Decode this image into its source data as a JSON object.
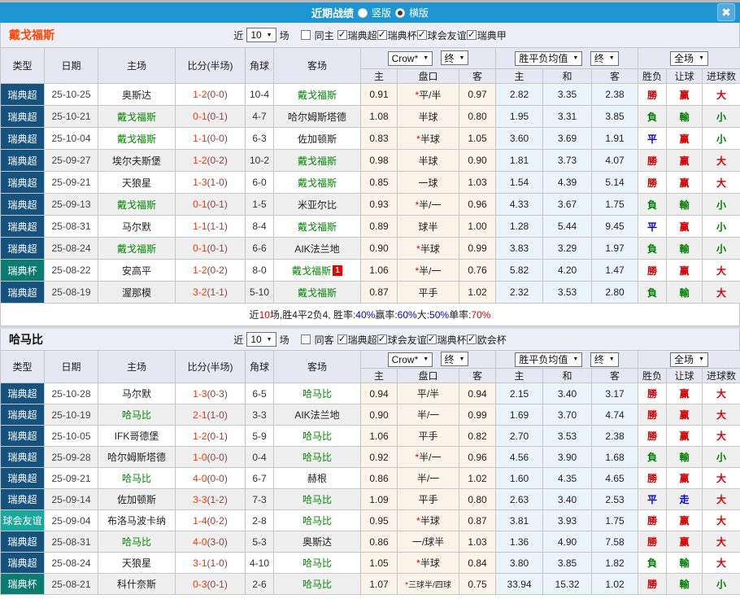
{
  "titlebar": {
    "title": "近期战绩",
    "vertical_label": "竖版",
    "horizontal_label": "横版",
    "close_glyph": "✖",
    "bar_color": "#1e96d3"
  },
  "columns": {
    "type": "类型",
    "date": "日期",
    "home": "主场",
    "score": "比分(半场)",
    "corner": "角球",
    "away": "客场",
    "asia_home": "主",
    "asia_handicap": "盘口",
    "asia_away": "客",
    "euro_home": "主",
    "euro_draw": "和",
    "euro_away": "客",
    "wl": "胜负",
    "handicap_result": "让球",
    "goals": "进球数"
  },
  "dropdowns": {
    "company": "Crow*",
    "company_final": "终",
    "avg": "胜平负均值",
    "avg_final": "终",
    "scope": "全场"
  },
  "league_colors": {
    "瑞典超": "#15527e",
    "瑞典杯": "#0c7c71",
    "球会友谊": "#18a89c"
  },
  "result_colors": {
    "r": "#d70000",
    "g": "#008000",
    "b": "#0000d0"
  },
  "sections": [
    {
      "team": "戴戈福斯",
      "team_color": "#ff4400",
      "filters": {
        "near_label": "近",
        "count": "10",
        "unit_label": "场",
        "same_checked": false,
        "same_label": "同主",
        "leagues": [
          {
            "label": "瑞典超",
            "checked": true
          },
          {
            "label": "瑞典杯",
            "checked": true
          },
          {
            "label": "球会友谊",
            "checked": true
          },
          {
            "label": "瑞典甲",
            "checked": true
          }
        ]
      },
      "rows": [
        {
          "league": "瑞典超",
          "date": "25-10-25",
          "home": "奥斯达",
          "home_focal": false,
          "ft": "1-2",
          "ht": "(0-0)",
          "corner": "10-4",
          "away": "戴戈福斯",
          "away_focal": true,
          "badge": "",
          "asia": [
            "0.91",
            "*平/半",
            "0.97"
          ],
          "euro": [
            "2.82",
            "3.35",
            "2.38"
          ],
          "results": [
            {
              "t": "勝",
              "c": "r"
            },
            {
              "t": "赢",
              "c": "r"
            },
            {
              "t": "大",
              "c": "r"
            }
          ]
        },
        {
          "league": "瑞典超",
          "date": "25-10-21",
          "home": "戴戈福斯",
          "home_focal": true,
          "ft": "0-1",
          "ht": "(0-1)",
          "corner": "4-7",
          "away": "哈尔姆斯塔德",
          "away_focal": false,
          "badge": "",
          "asia": [
            "1.08",
            "半球",
            "0.80"
          ],
          "euro": [
            "1.95",
            "3.31",
            "3.85"
          ],
          "results": [
            {
              "t": "負",
              "c": "g"
            },
            {
              "t": "輸",
              "c": "g"
            },
            {
              "t": "小",
              "c": "g"
            }
          ]
        },
        {
          "league": "瑞典超",
          "date": "25-10-04",
          "home": "戴戈福斯",
          "home_focal": true,
          "ft": "1-1",
          "ht": "(0-0)",
          "corner": "6-3",
          "away": "佐加顿斯",
          "away_focal": false,
          "badge": "",
          "asia": [
            "0.83",
            "*半球",
            "1.05"
          ],
          "euro": [
            "3.60",
            "3.69",
            "1.91"
          ],
          "results": [
            {
              "t": "平",
              "c": "b"
            },
            {
              "t": "赢",
              "c": "r"
            },
            {
              "t": "小",
              "c": "g"
            }
          ]
        },
        {
          "league": "瑞典超",
          "date": "25-09-27",
          "home": "埃尔夫斯堡",
          "home_focal": false,
          "ft": "1-2",
          "ht": "(0-2)",
          "corner": "10-2",
          "away": "戴戈福斯",
          "away_focal": true,
          "badge": "",
          "asia": [
            "0.98",
            "半球",
            "0.90"
          ],
          "euro": [
            "1.81",
            "3.73",
            "4.07"
          ],
          "results": [
            {
              "t": "勝",
              "c": "r"
            },
            {
              "t": "赢",
              "c": "r"
            },
            {
              "t": "大",
              "c": "r"
            }
          ]
        },
        {
          "league": "瑞典超",
          "date": "25-09-21",
          "home": "天狼星",
          "home_focal": false,
          "ft": "1-3",
          "ht": "(1-0)",
          "corner": "6-0",
          "away": "戴戈福斯",
          "away_focal": true,
          "badge": "",
          "asia": [
            "0.85",
            "一球",
            "1.03"
          ],
          "euro": [
            "1.54",
            "4.39",
            "5.14"
          ],
          "results": [
            {
              "t": "勝",
              "c": "r"
            },
            {
              "t": "赢",
              "c": "r"
            },
            {
              "t": "大",
              "c": "r"
            }
          ]
        },
        {
          "league": "瑞典超",
          "date": "25-09-13",
          "home": "戴戈福斯",
          "home_focal": true,
          "ft": "0-1",
          "ht": "(0-1)",
          "corner": "1-5",
          "away": "米亚尔比",
          "away_focal": false,
          "badge": "",
          "asia": [
            "0.93",
            "*半/一",
            "0.96"
          ],
          "euro": [
            "4.33",
            "3.67",
            "1.75"
          ],
          "results": [
            {
              "t": "負",
              "c": "g"
            },
            {
              "t": "輸",
              "c": "g"
            },
            {
              "t": "小",
              "c": "g"
            }
          ]
        },
        {
          "league": "瑞典超",
          "date": "25-08-31",
          "home": "马尔默",
          "home_focal": false,
          "ft": "1-1",
          "ht": "(1-1)",
          "corner": "8-4",
          "away": "戴戈福斯",
          "away_focal": true,
          "badge": "",
          "asia": [
            "0.89",
            "球半",
            "1.00"
          ],
          "euro": [
            "1.28",
            "5.44",
            "9.45"
          ],
          "results": [
            {
              "t": "平",
              "c": "b"
            },
            {
              "t": "赢",
              "c": "r"
            },
            {
              "t": "小",
              "c": "g"
            }
          ]
        },
        {
          "league": "瑞典超",
          "date": "25-08-24",
          "home": "戴戈福斯",
          "home_focal": true,
          "ft": "0-1",
          "ht": "(0-1)",
          "corner": "6-6",
          "away": "AIK法兰地",
          "away_focal": false,
          "badge": "",
          "asia": [
            "0.90",
            "*半球",
            "0.99"
          ],
          "euro": [
            "3.83",
            "3.29",
            "1.97"
          ],
          "results": [
            {
              "t": "負",
              "c": "g"
            },
            {
              "t": "輸",
              "c": "g"
            },
            {
              "t": "小",
              "c": "g"
            }
          ]
        },
        {
          "league": "瑞典杯",
          "date": "25-08-22",
          "home": "安高平",
          "home_focal": false,
          "ft": "1-2",
          "ht": "(0-2)",
          "corner": "8-0",
          "away": "戴戈福斯",
          "away_focal": true,
          "badge": "1",
          "asia": [
            "1.06",
            "*半/一",
            "0.76"
          ],
          "euro": [
            "5.82",
            "4.20",
            "1.47"
          ],
          "results": [
            {
              "t": "勝",
              "c": "r"
            },
            {
              "t": "赢",
              "c": "r"
            },
            {
              "t": "大",
              "c": "r"
            }
          ]
        },
        {
          "league": "瑞典超",
          "date": "25-08-19",
          "home": "渥那模",
          "home_focal": false,
          "ft": "3-2",
          "ht": "(1-1)",
          "corner": "5-10",
          "away": "戴戈福斯",
          "away_focal": true,
          "badge": "",
          "asia": [
            "0.87",
            "平手",
            "1.02"
          ],
          "euro": [
            "2.32",
            "3.53",
            "2.80"
          ],
          "results": [
            {
              "t": "負",
              "c": "g"
            },
            {
              "t": "輸",
              "c": "g"
            },
            {
              "t": "大",
              "c": "r"
            }
          ]
        }
      ],
      "summary": [
        {
          "t": "近",
          "c": "k"
        },
        {
          "t": "10",
          "c": "r"
        },
        {
          "t": "场,胜4平2负4, 胜率:",
          "c": "k"
        },
        {
          "t": "40%",
          "c": "b"
        },
        {
          "t": " 赢率:",
          "c": "k"
        },
        {
          "t": "60%",
          "c": "b"
        },
        {
          "t": " 大:",
          "c": "k"
        },
        {
          "t": "50%",
          "c": "b"
        },
        {
          "t": " 单率:",
          "c": "k"
        },
        {
          "t": "70%",
          "c": "r"
        }
      ]
    },
    {
      "team": "哈马比",
      "team_color": "#111111",
      "filters": {
        "near_label": "近",
        "count": "10",
        "unit_label": "场",
        "same_checked": false,
        "same_label": "同客",
        "leagues": [
          {
            "label": "瑞典超",
            "checked": true
          },
          {
            "label": "球会友谊",
            "checked": true
          },
          {
            "label": "瑞典杯",
            "checked": true
          },
          {
            "label": "欧会杯",
            "checked": true
          }
        ]
      },
      "rows": [
        {
          "league": "瑞典超",
          "date": "25-10-28",
          "home": "马尔默",
          "home_focal": false,
          "ft": "1-3",
          "ht": "(0-3)",
          "corner": "6-5",
          "away": "哈马比",
          "away_focal": true,
          "badge": "",
          "asia": [
            "0.94",
            "平/半",
            "0.94"
          ],
          "euro": [
            "2.15",
            "3.40",
            "3.17"
          ],
          "results": [
            {
              "t": "勝",
              "c": "r"
            },
            {
              "t": "赢",
              "c": "r"
            },
            {
              "t": "大",
              "c": "r"
            }
          ]
        },
        {
          "league": "瑞典超",
          "date": "25-10-19",
          "home": "哈马比",
          "home_focal": true,
          "ft": "2-1",
          "ht": "(1-0)",
          "corner": "3-3",
          "away": "AIK法兰地",
          "away_focal": false,
          "badge": "",
          "asia": [
            "0.90",
            "半/一",
            "0.99"
          ],
          "euro": [
            "1.69",
            "3.70",
            "4.74"
          ],
          "results": [
            {
              "t": "勝",
              "c": "r"
            },
            {
              "t": "赢",
              "c": "r"
            },
            {
              "t": "大",
              "c": "r"
            }
          ]
        },
        {
          "league": "瑞典超",
          "date": "25-10-05",
          "home": "IFK哥德堡",
          "home_focal": false,
          "ft": "1-2",
          "ht": "(0-1)",
          "corner": "5-9",
          "away": "哈马比",
          "away_focal": true,
          "badge": "",
          "asia": [
            "1.06",
            "平手",
            "0.82"
          ],
          "euro": [
            "2.70",
            "3.53",
            "2.38"
          ],
          "results": [
            {
              "t": "勝",
              "c": "r"
            },
            {
              "t": "赢",
              "c": "r"
            },
            {
              "t": "大",
              "c": "r"
            }
          ]
        },
        {
          "league": "瑞典超",
          "date": "25-09-28",
          "home": "哈尔姆斯塔德",
          "home_focal": false,
          "ft": "1-0",
          "ht": "(0-0)",
          "corner": "0-4",
          "away": "哈马比",
          "away_focal": true,
          "badge": "",
          "asia": [
            "0.92",
            "*半/一",
            "0.96"
          ],
          "euro": [
            "4.56",
            "3.90",
            "1.68"
          ],
          "results": [
            {
              "t": "負",
              "c": "g"
            },
            {
              "t": "輸",
              "c": "g"
            },
            {
              "t": "小",
              "c": "g"
            }
          ]
        },
        {
          "league": "瑞典超",
          "date": "25-09-21",
          "home": "哈马比",
          "home_focal": true,
          "ft": "4-0",
          "ht": "(0-0)",
          "corner": "6-7",
          "away": "赫根",
          "away_focal": false,
          "badge": "",
          "asia": [
            "0.86",
            "半/一",
            "1.02"
          ],
          "euro": [
            "1.60",
            "4.35",
            "4.65"
          ],
          "results": [
            {
              "t": "勝",
              "c": "r"
            },
            {
              "t": "赢",
              "c": "r"
            },
            {
              "t": "大",
              "c": "r"
            }
          ]
        },
        {
          "league": "瑞典超",
          "date": "25-09-14",
          "home": "佐加顿斯",
          "home_focal": false,
          "ft": "3-3",
          "ht": "(1-2)",
          "corner": "7-3",
          "away": "哈马比",
          "away_focal": true,
          "badge": "",
          "asia": [
            "1.09",
            "平手",
            "0.80"
          ],
          "euro": [
            "2.63",
            "3.40",
            "2.53"
          ],
          "results": [
            {
              "t": "平",
              "c": "b"
            },
            {
              "t": "走",
              "c": "b"
            },
            {
              "t": "大",
              "c": "r"
            }
          ]
        },
        {
          "league": "球会友谊",
          "date": "25-09-04",
          "home": "布洛马波卡纳",
          "home_focal": false,
          "ft": "1-4",
          "ht": "(0-2)",
          "corner": "2-8",
          "away": "哈马比",
          "away_focal": true,
          "badge": "",
          "asia": [
            "0.95",
            "*半球",
            "0.87"
          ],
          "euro": [
            "3.81",
            "3.93",
            "1.75"
          ],
          "results": [
            {
              "t": "勝",
              "c": "r"
            },
            {
              "t": "赢",
              "c": "r"
            },
            {
              "t": "大",
              "c": "r"
            }
          ]
        },
        {
          "league": "瑞典超",
          "date": "25-08-31",
          "home": "哈马比",
          "home_focal": true,
          "ft": "4-0",
          "ht": "(3-0)",
          "corner": "5-3",
          "away": "奥斯达",
          "away_focal": false,
          "badge": "",
          "asia": [
            "0.86",
            "一/球半",
            "1.03"
          ],
          "euro": [
            "1.36",
            "4.90",
            "7.58"
          ],
          "results": [
            {
              "t": "勝",
              "c": "r"
            },
            {
              "t": "赢",
              "c": "r"
            },
            {
              "t": "大",
              "c": "r"
            }
          ]
        },
        {
          "league": "瑞典超",
          "date": "25-08-24",
          "home": "天狼星",
          "home_focal": false,
          "ft": "3-1",
          "ht": "(1-0)",
          "corner": "4-10",
          "away": "哈马比",
          "away_focal": true,
          "badge": "",
          "asia": [
            "1.05",
            "*半球",
            "0.84"
          ],
          "euro": [
            "3.80",
            "3.85",
            "1.82"
          ],
          "results": [
            {
              "t": "負",
              "c": "g"
            },
            {
              "t": "輸",
              "c": "g"
            },
            {
              "t": "大",
              "c": "r"
            }
          ]
        },
        {
          "league": "瑞典杯",
          "date": "25-08-21",
          "home": "科什奈斯",
          "home_focal": false,
          "ft": "0-3",
          "ht": "(0-1)",
          "corner": "2-6",
          "away": "哈马比",
          "away_focal": true,
          "badge": "",
          "asia": [
            "1.07",
            "*三球半/四球",
            "0.75"
          ],
          "euro": [
            "33.94",
            "15.32",
            "1.02"
          ],
          "results": [
            {
              "t": "勝",
              "c": "r"
            },
            {
              "t": "輸",
              "c": "g"
            },
            {
              "t": "小",
              "c": "g"
            }
          ]
        }
      ],
      "summary": null
    }
  ]
}
